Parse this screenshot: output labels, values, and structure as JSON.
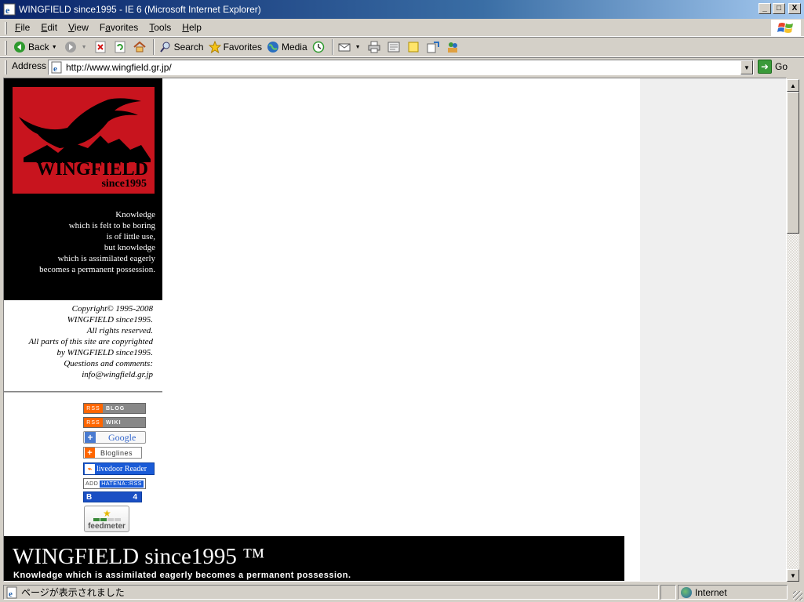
{
  "window": {
    "title": "WINGFIELD since1995 - IE 6 (Microsoft Internet Explorer)",
    "controls": {
      "minimize": "_",
      "maximize": "□",
      "close": "X"
    }
  },
  "menu": {
    "items": [
      {
        "label": "File",
        "key": "F",
        "rest": "ile"
      },
      {
        "label": "Edit",
        "key": "E",
        "rest": "dit"
      },
      {
        "label": "View",
        "key": "V",
        "rest": "iew"
      },
      {
        "label": "Favorites",
        "key": "a",
        "pre": "F",
        "rest": "vorites"
      },
      {
        "label": "Tools",
        "key": "T",
        "rest": "ools"
      },
      {
        "label": "Help",
        "key": "H",
        "rest": "elp"
      }
    ]
  },
  "toolbar": {
    "back_label": "Back",
    "search_label": "Search",
    "favorites_label": "Favorites",
    "media_label": "Media"
  },
  "address": {
    "label": "Address",
    "url": "http://www.wingfield.gr.jp/",
    "go_label": "Go"
  },
  "page": {
    "logo_name": "WINGFIELD",
    "logo_since": "since1995",
    "quote": [
      "Knowledge",
      "which is felt to be boring",
      "is of little use,",
      "but knowledge",
      "which is assimilated eagerly",
      "becomes a permanent possession."
    ],
    "copyright": [
      "Copyright© 1995-2008",
      "WINGFIELD since1995.",
      "All rights reserved.",
      "All parts of this site are copyrighted",
      "by WINGFIELD since1995.",
      "Questions and comments:",
      "info@wingfield.gr.jp"
    ],
    "badges": {
      "rss_blog": {
        "left": "RSS",
        "right": "BLOG"
      },
      "rss_wiki": {
        "left": "RSS",
        "right": "WIKI"
      },
      "google": "Google",
      "bloglines": "Bloglines",
      "livedoor": "livedoor Reader",
      "hatena": {
        "left": "ADD",
        "right": "HATENA::RSS"
      },
      "hatena_bookmark": {
        "left": "B",
        "count": "4"
      },
      "feedmeter": "feedmeter"
    },
    "footer_title": "WINGFIELD since1995 ™",
    "footer_tagline": "Knowledge which is assimilated eagerly becomes a permanent possession."
  },
  "status": {
    "text": "ページが表示されました",
    "zone": "Internet"
  },
  "colors": {
    "logo_red": "#c8141e",
    "titlebar": "#0a246a",
    "chrome": "#d4d0c8"
  }
}
